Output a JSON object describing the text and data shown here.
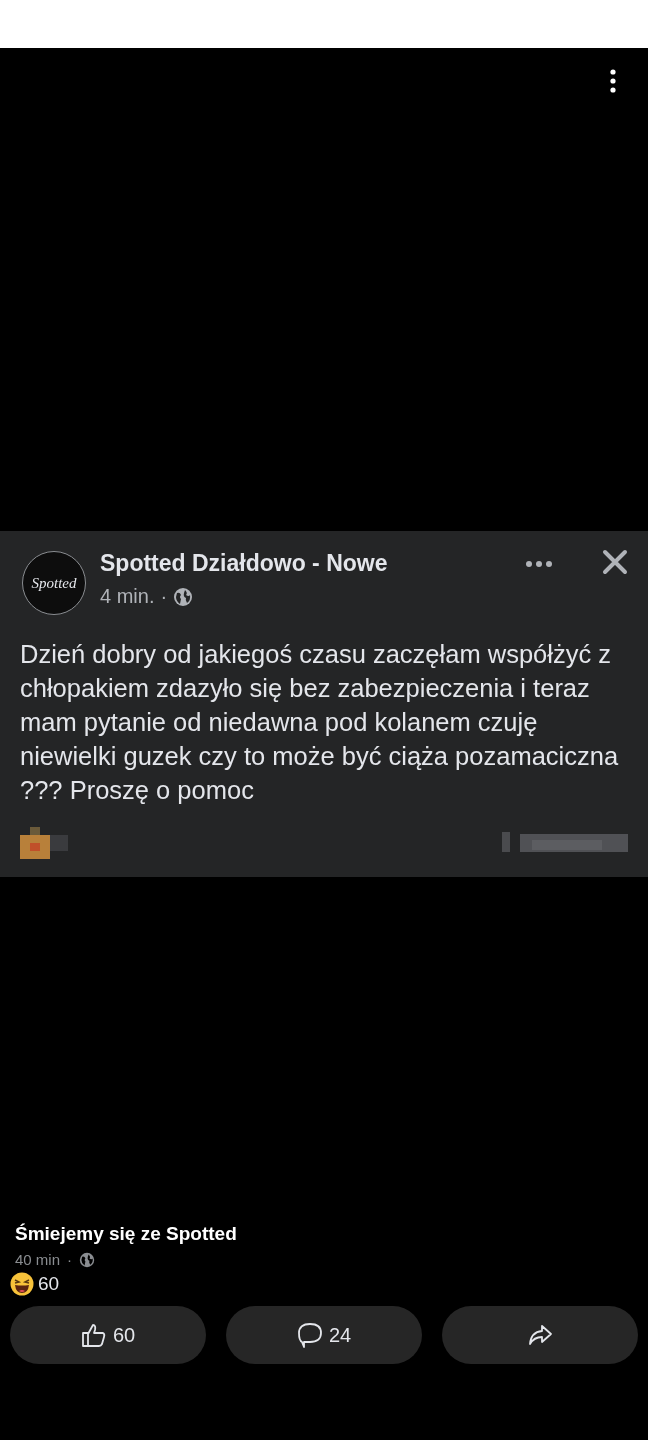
{
  "shared_post": {
    "page_name": "Spotted Działdowo - Nowe",
    "avatar_text": "Spotted",
    "time": "4 min.",
    "separator": "·",
    "body": "Dzień dobry od jakiegoś czasu zaczęłam współżyć z chłopakiem zdazyło się bez zabezpieczenia i teraz mam pytanie od niedawna pod kolanem czuję niewielki guzek czy to może być ciąża pozamaciczna ??? Proszę o pomoc"
  },
  "feed_post": {
    "author": "Śmiejemy się ze Spotted",
    "time": "40 min",
    "separator": "·",
    "reaction_count": "60",
    "actions": [
      {
        "kind": "like",
        "label": "60"
      },
      {
        "kind": "comment",
        "label": "24"
      },
      {
        "kind": "share"
      }
    ]
  }
}
